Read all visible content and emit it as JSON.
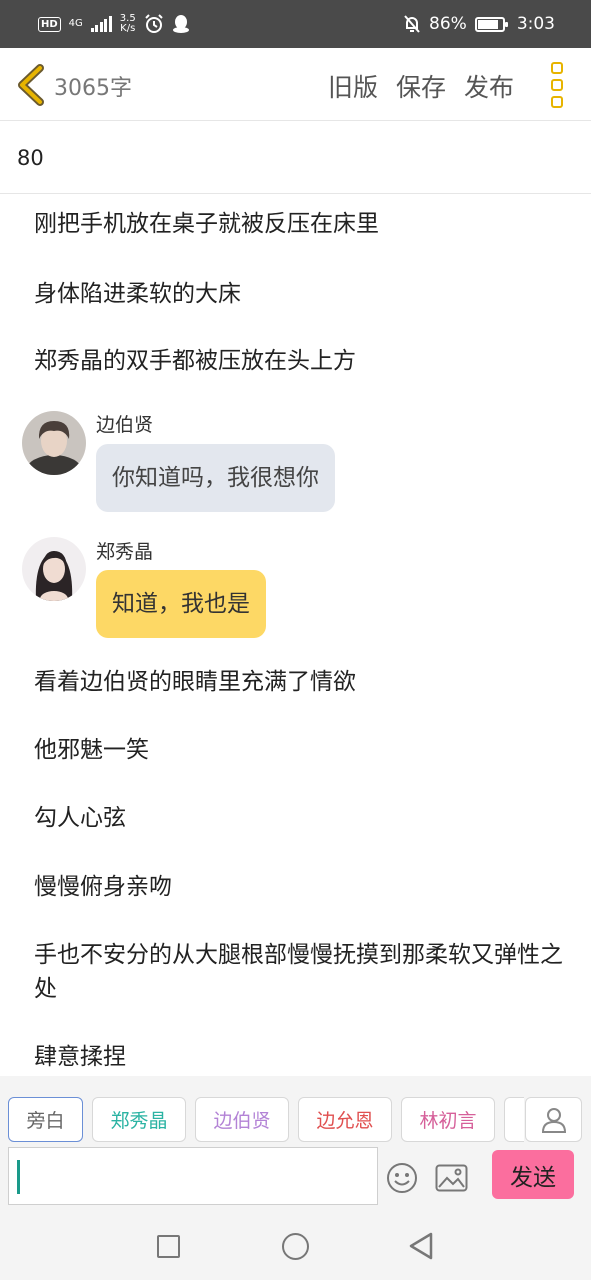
{
  "status_bar": {
    "hd": "HD",
    "network_type": "4G",
    "speed_value": "3.5",
    "speed_unit": "K/s",
    "battery_percent": "86%",
    "battery_level": 0.86,
    "time": "3:03"
  },
  "header": {
    "word_count": "3065字",
    "old_version": "旧版",
    "save": "保存",
    "publish": "发布",
    "accent_color": "#e7b400"
  },
  "title": "80",
  "content": {
    "para1": "刚把手机放在桌子就被反压在床里",
    "para2": "身体陷进柔软的大床",
    "para3": "郑秀晶的双手都被压放在头上方",
    "chat1": {
      "speaker": "边伯贤",
      "text": "你知道吗，我很想你"
    },
    "chat2": {
      "speaker": "郑秀晶",
      "text": "知道，我也是"
    },
    "para4": "看着边伯贤的眼睛里充满了情欲",
    "para5": "他邪魅一笑",
    "para6": "勾人心弦",
    "para7": "慢慢俯身亲吻",
    "para8": "手也不安分的从大腿根部慢慢抚摸到那柔软又弹性之处",
    "para9": "肆意揉捏"
  },
  "toolbar": {
    "roles": [
      {
        "label": "旁白",
        "color": "#666666"
      },
      {
        "label": "郑秀晶",
        "color": "#2bb3a3"
      },
      {
        "label": "边伯贤",
        "color": "#b383d6"
      },
      {
        "label": "边允恩",
        "color": "#e05050"
      },
      {
        "label": "林初言",
        "color": "#d6609a"
      }
    ],
    "send": "发送",
    "send_color": "#fb6e9e"
  }
}
